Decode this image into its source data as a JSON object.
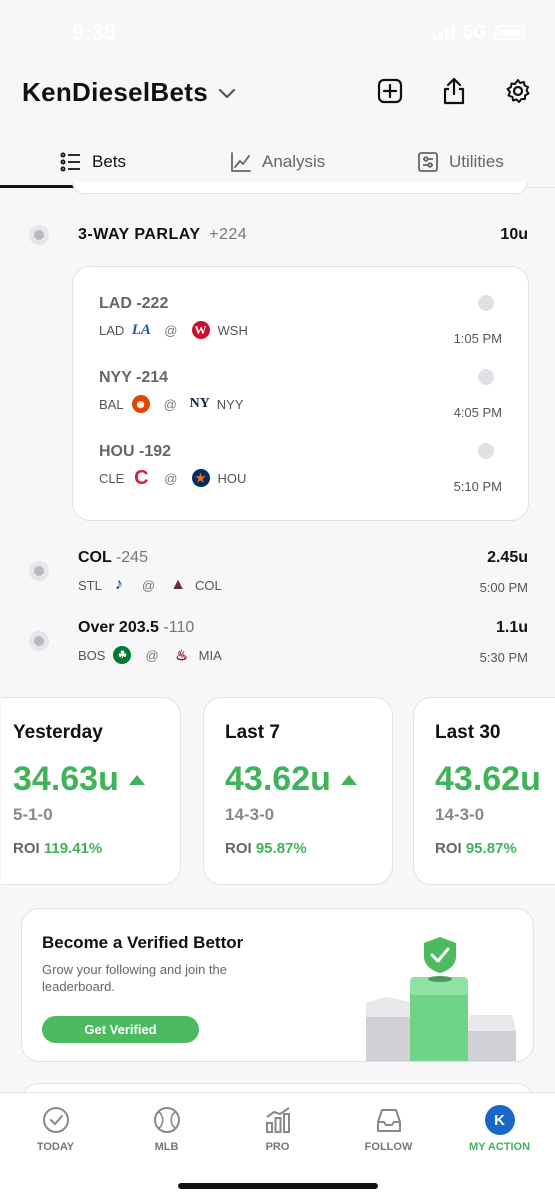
{
  "status_bar": {
    "time": "9:35",
    "network": "5G"
  },
  "header": {
    "account_name": "KenDieselBets"
  },
  "tabs": [
    {
      "label": "Bets",
      "icon": "list-icon"
    },
    {
      "label": "Analysis",
      "icon": "chart-line-icon"
    },
    {
      "label": "Utilities",
      "icon": "sliders-icon"
    }
  ],
  "parlay": {
    "title": "3-WAY PARLAY",
    "odds": "+224",
    "units": "10u",
    "legs": [
      {
        "pick": "LAD -222",
        "away": "LAD",
        "home": "WSH",
        "time": "1:05 PM"
      },
      {
        "pick": "NYY -214",
        "away": "BAL",
        "home": "NYY",
        "time": "4:05 PM"
      },
      {
        "pick": "HOU -192",
        "away": "CLE",
        "home": "HOU",
        "time": "5:10 PM"
      }
    ]
  },
  "bets": [
    {
      "pick": "COL",
      "odds": "-245",
      "units": "2.45u",
      "away": "STL",
      "home": "COL",
      "time": "5:00 PM"
    },
    {
      "pick": "Over 203.5",
      "odds": "-110",
      "units": "1.1u",
      "away": "BOS",
      "home": "MIA",
      "time": "5:30 PM"
    }
  ],
  "at_symbol": "@",
  "stats": [
    {
      "label": "Yesterday",
      "value": "34.63u",
      "record": "5-1-0",
      "roi_label": "ROI",
      "roi": "119.41%"
    },
    {
      "label": "Last 7",
      "value": "43.62u",
      "record": "14-3-0",
      "roi_label": "ROI",
      "roi": "95.87%"
    },
    {
      "label": "Last 30",
      "value": "43.62u",
      "record": "14-3-0",
      "roi_label": "ROI",
      "roi": "95.87%"
    }
  ],
  "verify": {
    "title": "Become a Verified Bettor",
    "description": "Grow your following and join the leaderboard.",
    "button": "Get Verified"
  },
  "nav": [
    {
      "label": "TODAY",
      "icon": "check-circle-icon"
    },
    {
      "label": "MLB",
      "icon": "baseball-icon"
    },
    {
      "label": "PRO",
      "icon": "bar-chart-icon"
    },
    {
      "label": "FOLLOW",
      "icon": "inbox-icon"
    },
    {
      "label": "MY ACTION",
      "icon": "avatar-icon",
      "avatar_letter": "K"
    }
  ],
  "colors": {
    "accent_green": "#3fb35a",
    "avatar_blue": "#1a67c9"
  }
}
